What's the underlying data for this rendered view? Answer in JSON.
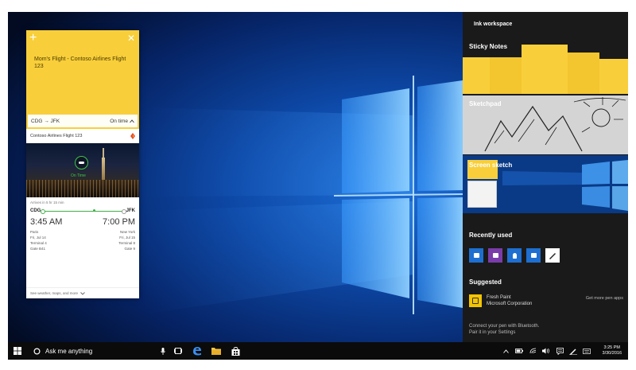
{
  "desktop": {
    "wallpaper": "windows-10-hero"
  },
  "sticky_note": {
    "add_icon": "plus-icon",
    "close_icon": "close-icon",
    "title": "Mom's Flight - Contoso Airlines Flight 123",
    "route": "CDG → JFK",
    "status": "On time",
    "status_icon": "chevron-up-icon",
    "card": {
      "airline": "Contoso Airlines Flight 123",
      "photo_badge": "On Time",
      "arrive_note": "Arrives in 5 hr 15 min",
      "origin": "CDG",
      "destination": "JFK",
      "depart_time": "3:45 AM",
      "arrive_time": "7:00 PM",
      "depart": {
        "city": "Paris",
        "date": "Fri, Jul 14",
        "terminal": "Terminal 4",
        "gate": "Gate B41"
      },
      "arrive": {
        "city": "New York",
        "date": "Fri, Jul 15",
        "terminal": "Terminal 8",
        "gate": "Gate 9"
      },
      "see_more": "See weather, maps, and more"
    }
  },
  "ink_workspace": {
    "title": "Ink workspace",
    "sticky_notes": "Sticky Notes",
    "sketchpad": "Sketchpad",
    "screen_sketch": "Screen sketch",
    "recently_used": "Recently used",
    "recent_apps": [
      {
        "icon": "video-app-icon",
        "color": "#1e6fd0"
      },
      {
        "icon": "onenote-app-icon",
        "color": "#7a3ca8"
      },
      {
        "icon": "maps-app-icon",
        "color": "#1e6fd0"
      },
      {
        "icon": "store-app-icon",
        "color": "#1e6fd0"
      },
      {
        "icon": "pen-app-icon",
        "color": "#ffffff"
      }
    ],
    "suggested": "Suggested",
    "suggested_app": {
      "name": "Fresh Paint",
      "publisher": "Microsoft Corporation"
    },
    "get_more": "Get more pen apps",
    "bluetooth_line1": "Connect your pen with Bluetooth.",
    "bluetooth_line2": "Pair it in your Settings"
  },
  "taskbar": {
    "search_placeholder": "Ask me anything",
    "time": "3:25 PM",
    "date": "3/30/2016"
  },
  "colors": {
    "accent": "#1e6fd0",
    "note_yellow": "#f8cf3a",
    "taskbar": "#0b0b0b",
    "on_time_green": "#43b04a"
  }
}
